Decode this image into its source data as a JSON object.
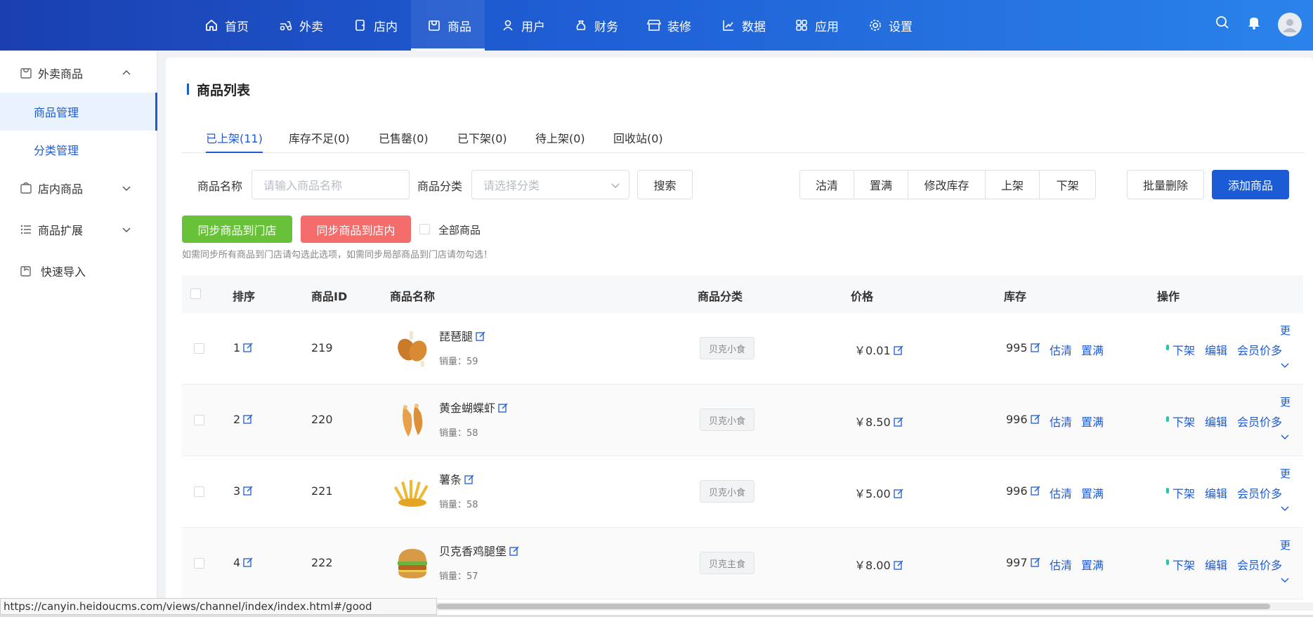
{
  "nav": {
    "items": [
      {
        "label": "首页",
        "icon": "home-icon"
      },
      {
        "label": "外卖",
        "icon": "scooter-icon"
      },
      {
        "label": "店内",
        "icon": "store-icon"
      },
      {
        "label": "商品",
        "icon": "goods-icon"
      },
      {
        "label": "用户",
        "icon": "user-icon"
      },
      {
        "label": "财务",
        "icon": "money-bag-icon"
      },
      {
        "label": "装修",
        "icon": "shop-decor-icon"
      },
      {
        "label": "数据",
        "icon": "chart-icon"
      },
      {
        "label": "应用",
        "icon": "apps-icon"
      },
      {
        "label": "设置",
        "icon": "gear-icon"
      }
    ],
    "active_index": 3
  },
  "sidebar": {
    "groups": [
      {
        "label": "外卖商品",
        "expanded": true
      },
      {
        "label": "店内商品",
        "expanded": false
      },
      {
        "label": "商品扩展",
        "expanded": false
      },
      {
        "label": "快速导入"
      }
    ],
    "subitems": [
      {
        "label": "商品管理",
        "active": true
      },
      {
        "label": "分类管理",
        "active": false
      }
    ]
  },
  "page": {
    "title": "商品列表"
  },
  "tabs": [
    {
      "label": "已上架(11)",
      "active": true
    },
    {
      "label": "库存不足(0)"
    },
    {
      "label": "已售罄(0)"
    },
    {
      "label": "已下架(0)"
    },
    {
      "label": "待上架(0)"
    },
    {
      "label": "回收站(0)"
    }
  ],
  "filters": {
    "name_label": "商品名称",
    "name_placeholder": "请输入商品名称",
    "category_label": "商品分类",
    "category_placeholder": "请选择分类",
    "search_button": "搜索"
  },
  "actions": {
    "group": [
      "沽清",
      "置满",
      "修改库存",
      "上架",
      "下架"
    ],
    "batch_delete": "批量删除",
    "add_product": "添加商品",
    "sync_store": "同步商品到门店",
    "sync_instore": "同步商品到店内",
    "all_products": "全部商品",
    "hint": "如需同步所有商品到门店请勾选此选项，如需同步局部商品到门店请勿勾选！"
  },
  "table": {
    "headers": [
      "排序",
      "商品ID",
      "商品名称",
      "商品分类",
      "价格",
      "库存",
      "操作"
    ],
    "rows": [
      {
        "sort": "1",
        "id": "219",
        "name": "琵琶腿",
        "sales": "销量：59",
        "category": "贝克小食",
        "price": "￥0.01",
        "stock": "995",
        "image": "fried-drumsticks"
      },
      {
        "sort": "2",
        "id": "220",
        "name": "黄金蝴蝶虾",
        "sales": "销量：58",
        "category": "贝克小食",
        "price": "￥8.50",
        "stock": "996",
        "image": "butterfly-shrimp"
      },
      {
        "sort": "3",
        "id": "221",
        "name": "薯条",
        "sales": "销量：58",
        "category": "贝克小食",
        "price": "￥5.00",
        "stock": "996",
        "image": "french-fries"
      },
      {
        "sort": "4",
        "id": "222",
        "name": "贝克香鸡腿堡",
        "sales": "销量：57",
        "category": "贝克主食",
        "price": "￥8.00",
        "stock": "997",
        "image": "chicken-burger"
      }
    ],
    "stock_links": [
      "估清",
      "置满"
    ],
    "op_links": [
      "下架",
      "编辑",
      "会员价多"
    ],
    "more_label": "更"
  },
  "status_bar": {
    "url": "https://canyin.heidoucms.com/views/channel/index/index.html#/good"
  },
  "colors": {
    "primary": "#1c5bd6",
    "nav_gradient_start": "#1a3fb0",
    "nav_gradient_end": "#2a83ea",
    "green": "#67c23a",
    "red": "#f56c6c",
    "status_dot": "#20c9a8"
  }
}
